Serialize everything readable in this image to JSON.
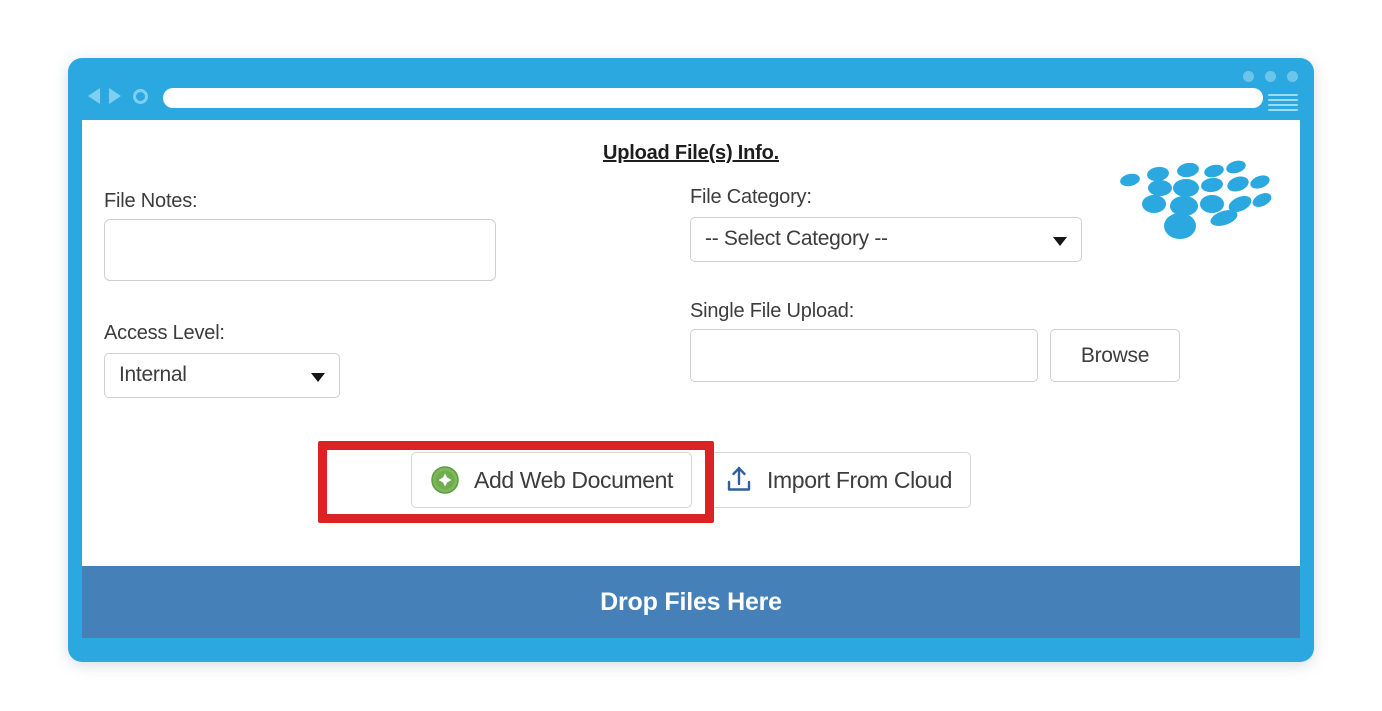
{
  "browser": {
    "address_value": "",
    "address_placeholder": "",
    "back_icon": "back-triangle-icon",
    "forward_icon": "forward-triangle-icon",
    "reload_icon": "reload-circle-icon",
    "menu_icon": "hamburger-menu-icon",
    "window_dots": [
      "dot",
      "dot",
      "dot"
    ],
    "chrome_color": "#2ba8e0"
  },
  "panel": {
    "title": "Upload File(s) Info.",
    "logo_icon": "scattered-dots-logo",
    "logo_color": "#2ba8e0"
  },
  "form": {
    "file_notes": {
      "label": "File Notes:",
      "value": "",
      "placeholder": ""
    },
    "file_category": {
      "label": "File Category:",
      "selected": "-- Select Category --",
      "caret_icon": "chevron-down-icon"
    },
    "access_level": {
      "label": "Access Level:",
      "selected": "Internal",
      "caret_icon": "chevron-down-icon"
    },
    "single_file_upload": {
      "label": "Single File Upload:",
      "value": "",
      "placeholder": "",
      "browse_label": "Browse"
    }
  },
  "actions": {
    "add_web_document": {
      "label": "Add Web Document",
      "icon": "green-plus-circle-icon",
      "icon_color": "#6cab4c",
      "highlighted": true,
      "highlight_color": "#dc2222"
    },
    "import_from_cloud": {
      "label": "Import From Cloud",
      "icon": "upload-tray-icon",
      "icon_color": "#2f5f9e"
    }
  },
  "drop_zone": {
    "label": "Drop Files Here",
    "background_color": "#4581b8",
    "text_color": "#ffffff"
  }
}
